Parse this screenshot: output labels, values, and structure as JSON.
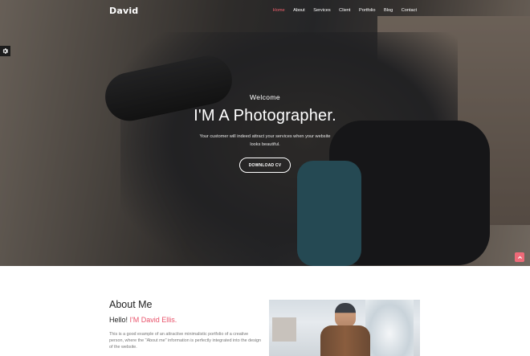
{
  "brand": "David",
  "nav": [
    "Home",
    "About",
    "Services",
    "Client",
    "Portfolio",
    "Blog",
    "Contact"
  ],
  "active_nav": "Home",
  "hero": {
    "welcome": "Welcome",
    "title": "I'M A Photographer.",
    "subtitle_line1": "Your customer will indeed attract your services when your website",
    "subtitle_line2": "looks beautiful.",
    "button": "DOWNLOAD CV"
  },
  "about": {
    "title": "About Me",
    "hello": "Hello!",
    "name": "I'M David Ellis.",
    "text": "This is a good example of an attractive minimalistic portfolio of a creative person, where the \"About me\" information is perfectly integrated into the design of the website."
  },
  "colors": {
    "accent": "#f2616e",
    "scroll_top": "#ee6a78"
  },
  "icons": {
    "settings": "gear-icon",
    "scroll_top": "chevron-up-icon"
  }
}
